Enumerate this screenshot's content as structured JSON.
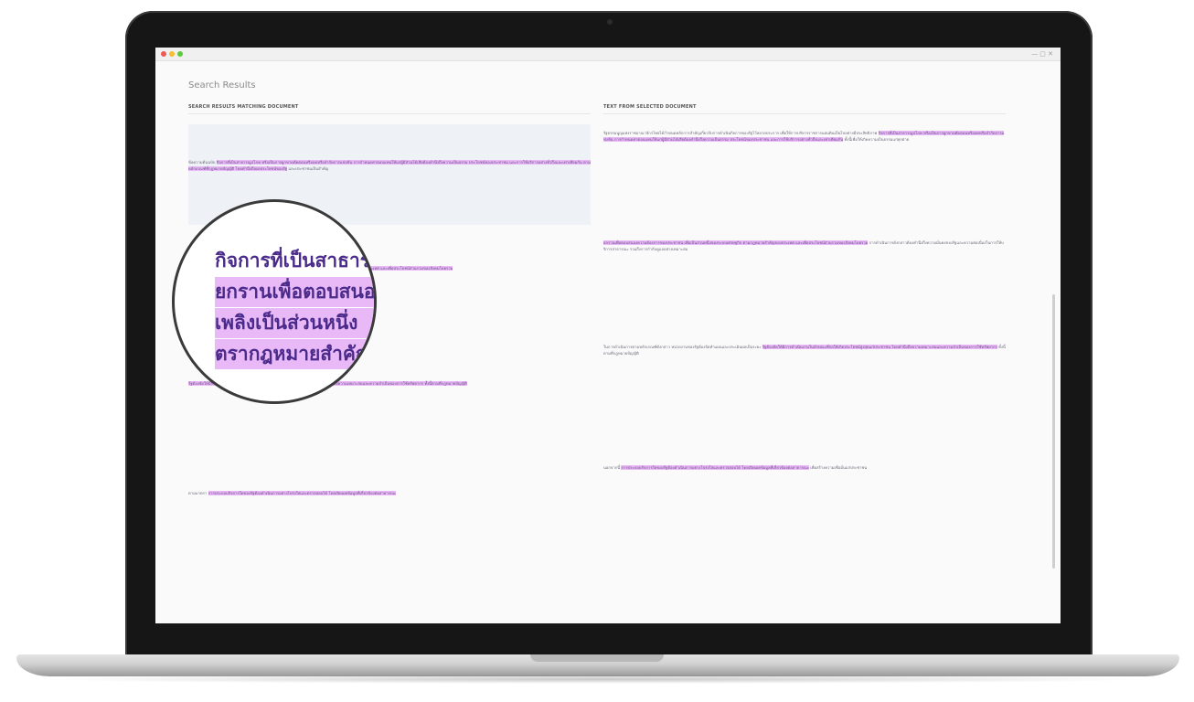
{
  "app": {
    "title": "Search Results"
  },
  "window": {
    "controls": "— ▢ ✕"
  },
  "left_panel": {
    "header": "SEARCH RESULTS MATCHING DOCUMENT",
    "paragraphs": [
      {
        "plain_start": "ข้อความต้นฉบับ ",
        "highlight": "กิจการที่เป็นสาธารณูปโภค หรือเป็นการผูกขาดตัดตอนหรือลดหรือจำกัดการแข่งขัน การกำหนดค่าตอบแทนให้แก่ผู้มีส่วนได้เสียต้องคำนึงถึงความเป็นธรรม ประโยชน์ของประชาชน และการใช้บริการอย่างทั่วถึงและเท่าเทียมกัน ตามหลักเกณฑ์ที่กฎหมายบัญญัติ โดยคำนึงถึงผลประโยชน์ของรัฐ",
        "plain_end": " และประชาชนเป็นสำคัญ"
      },
      {
        "plain_start": "",
        "highlight": "ยกรานเพื่อตอบสนองความต้องการของประชาชน เพื่อเป็นส่วนหนึ่งของระบบเศรษฐกิจ ตามกฎหมายสำคัญของประเทศ และเพื่อประโยชน์ส่วนรวมของสังคมโดยรวม",
        "plain_end": ""
      },
      {
        "plain_start": "",
        "highlight": "รัฐต้องจัดให้มีการดำเนินงานในลักษณะที่ก่อให้เกิดประโยชน์สูงสุดแก่ประชาชน โดยคำนึงถึงความเหมาะสมและความจำเป็นของการใช้ทรัพยากร ทั้งนี้ตามที่กฎหมายบัญญัติ",
        "plain_end": ""
      },
      {
        "plain_start": "ตามมาตรา ",
        "highlight": "การประกอบกิจการใดของรัฐต้องดำเนินการอย่างโปร่งใสและตรวจสอบได้ โดยเปิดเผยข้อมูลที่เกี่ยวข้องต่อสาธารณะ",
        "plain_end": ""
      }
    ]
  },
  "right_panel": {
    "header": "TEXT FROM SELECTED DOCUMENT",
    "paragraphs": [
      {
        "plain_start": "รัฐธรรมนูญแห่งราชอาณาจักรไทยได้กำหนดหลักการสำคัญเกี่ยวกับการดำเนินกิจการของรัฐไว้หลายประการ เพื่อให้การบริหารราชการแผ่นดินเป็นไปอย่างมีประสิทธิภาพ ",
        "highlight": "กิจการที่เป็นสาธารณูปโภค หรือเป็นการผูกขาดตัดตอนหรือลดหรือจำกัดการแข่งขัน การกำหนดค่าตอบแทนให้แก่ผู้มีส่วนได้เสียต้องคำนึงถึงความเป็นธรรม ประโยชน์ของประชาชน และการใช้บริการอย่างทั่วถึงและเท่าเทียมกัน",
        "plain_end": " ทั้งนี้เพื่อให้เกิดความเป็นธรรมแก่ทุกฝ่าย"
      },
      {
        "plain_start": "",
        "highlight": "ยกรานเพื่อตอบสนองความต้องการของประชาชน เพื่อเป็นส่วนหนึ่งของระบบเศรษฐกิจ ตามกฎหมายสำคัญของประเทศ และเพื่อประโยชน์ส่วนรวมของสังคมโดยรวม",
        "plain_end": " การดำเนินการดังกล่าวต้องคำนึงถึงความมั่นคงของรัฐและความต่อเนื่องในการให้บริการสาธารณะ รวมถึงการกำกับดูแลอย่างเหมาะสม"
      },
      {
        "plain_start": "ในการดำเนินการตามหลักเกณฑ์ดังกล่าว หน่วยงานของรัฐต้องจัดทำแผนและประเมินผลเป็นระยะ ",
        "highlight": "รัฐต้องจัดให้มีการดำเนินงานในลักษณะที่ก่อให้เกิดประโยชน์สูงสุดแก่ประชาชน โดยคำนึงถึงความเหมาะสมและความจำเป็นของการใช้ทรัพยากร",
        "plain_end": " ทั้งนี้ตามที่กฎหมายบัญญัติ"
      },
      {
        "plain_start": "นอกจากนี้ ",
        "highlight": "การประกอบกิจการใดของรัฐต้องดำเนินการอย่างโปร่งใสและตรวจสอบได้ โดยเปิดเผยข้อมูลที่เกี่ยวข้องต่อสาธารณะ",
        "plain_end": " เพื่อสร้างความเชื่อมั่นแก่ประชาชน"
      }
    ]
  },
  "magnifier": {
    "lines": [
      "กิจการที่เป็นสาธารณ",
      "ยกรานเพื่อตอบสนอง",
      "เพลิงเป็นส่วนหนึ่ง",
      "ตรากฎหมายสำคัญ"
    ]
  },
  "colors": {
    "highlight": "#e9b8f6",
    "highlight_text": "#6a4f8a",
    "magnified_text": "#4a2a8a"
  }
}
